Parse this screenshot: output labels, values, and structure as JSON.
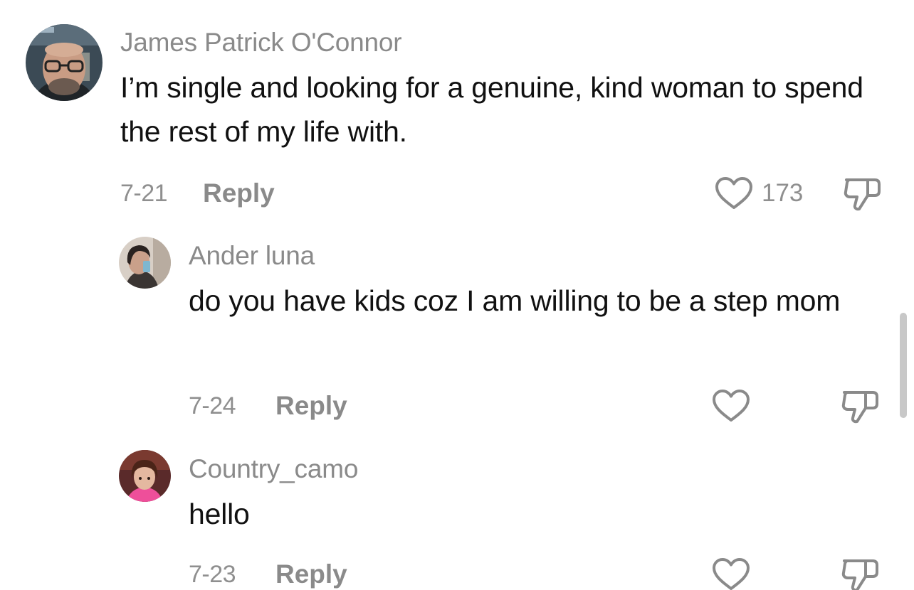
{
  "comments": [
    {
      "username": "James Patrick O'Connor",
      "text": "I’m single and looking for a genuine, kind woman to spend the rest of my life with.",
      "date": "7-21",
      "reply_label": "Reply",
      "like_count": "173",
      "avatar_icon": "bearded-man-glasses-avatar"
    },
    {
      "username": "Ander luna",
      "text": "do you have kids coz I am willing to be a step mom",
      "date": "7-24",
      "reply_label": "Reply",
      "like_count": "",
      "avatar_icon": "woman-selfie-avatar"
    },
    {
      "username": "Country_camo",
      "text": "hello",
      "date": "7-23",
      "reply_label": "Reply",
      "like_count": "",
      "avatar_icon": "girl-pink-shirt-avatar"
    }
  ],
  "colors": {
    "username": "#8a8a8a",
    "text": "#111111",
    "meta": "#8f8f8f",
    "icon": "#8a8a8a",
    "scrollbar": "#c8c8c8"
  }
}
